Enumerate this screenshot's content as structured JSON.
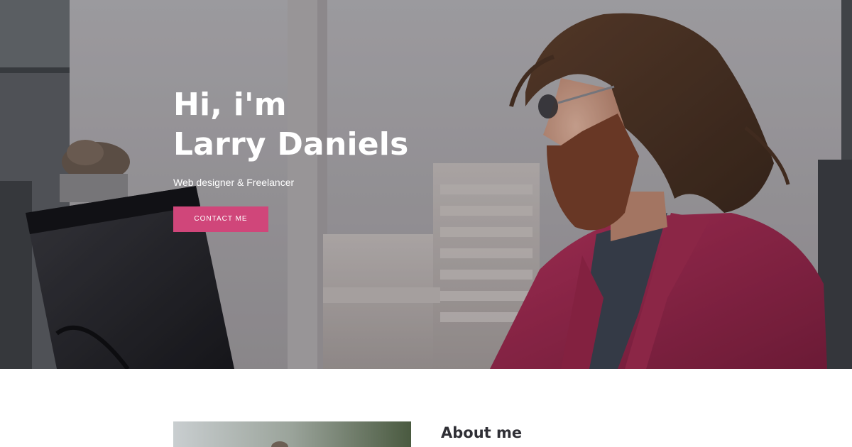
{
  "hero": {
    "greeting": "Hi, i'm",
    "name": "Larry Daniels",
    "subtitle": "Web designer & Freelancer",
    "contact_button_label": "CONTACT ME",
    "photo_subject": "bearded man in sunglasses and pink blazer with laptop",
    "accent_color": "#d0467a"
  },
  "about": {
    "heading": "About me",
    "image_subject": "portrait photo"
  }
}
